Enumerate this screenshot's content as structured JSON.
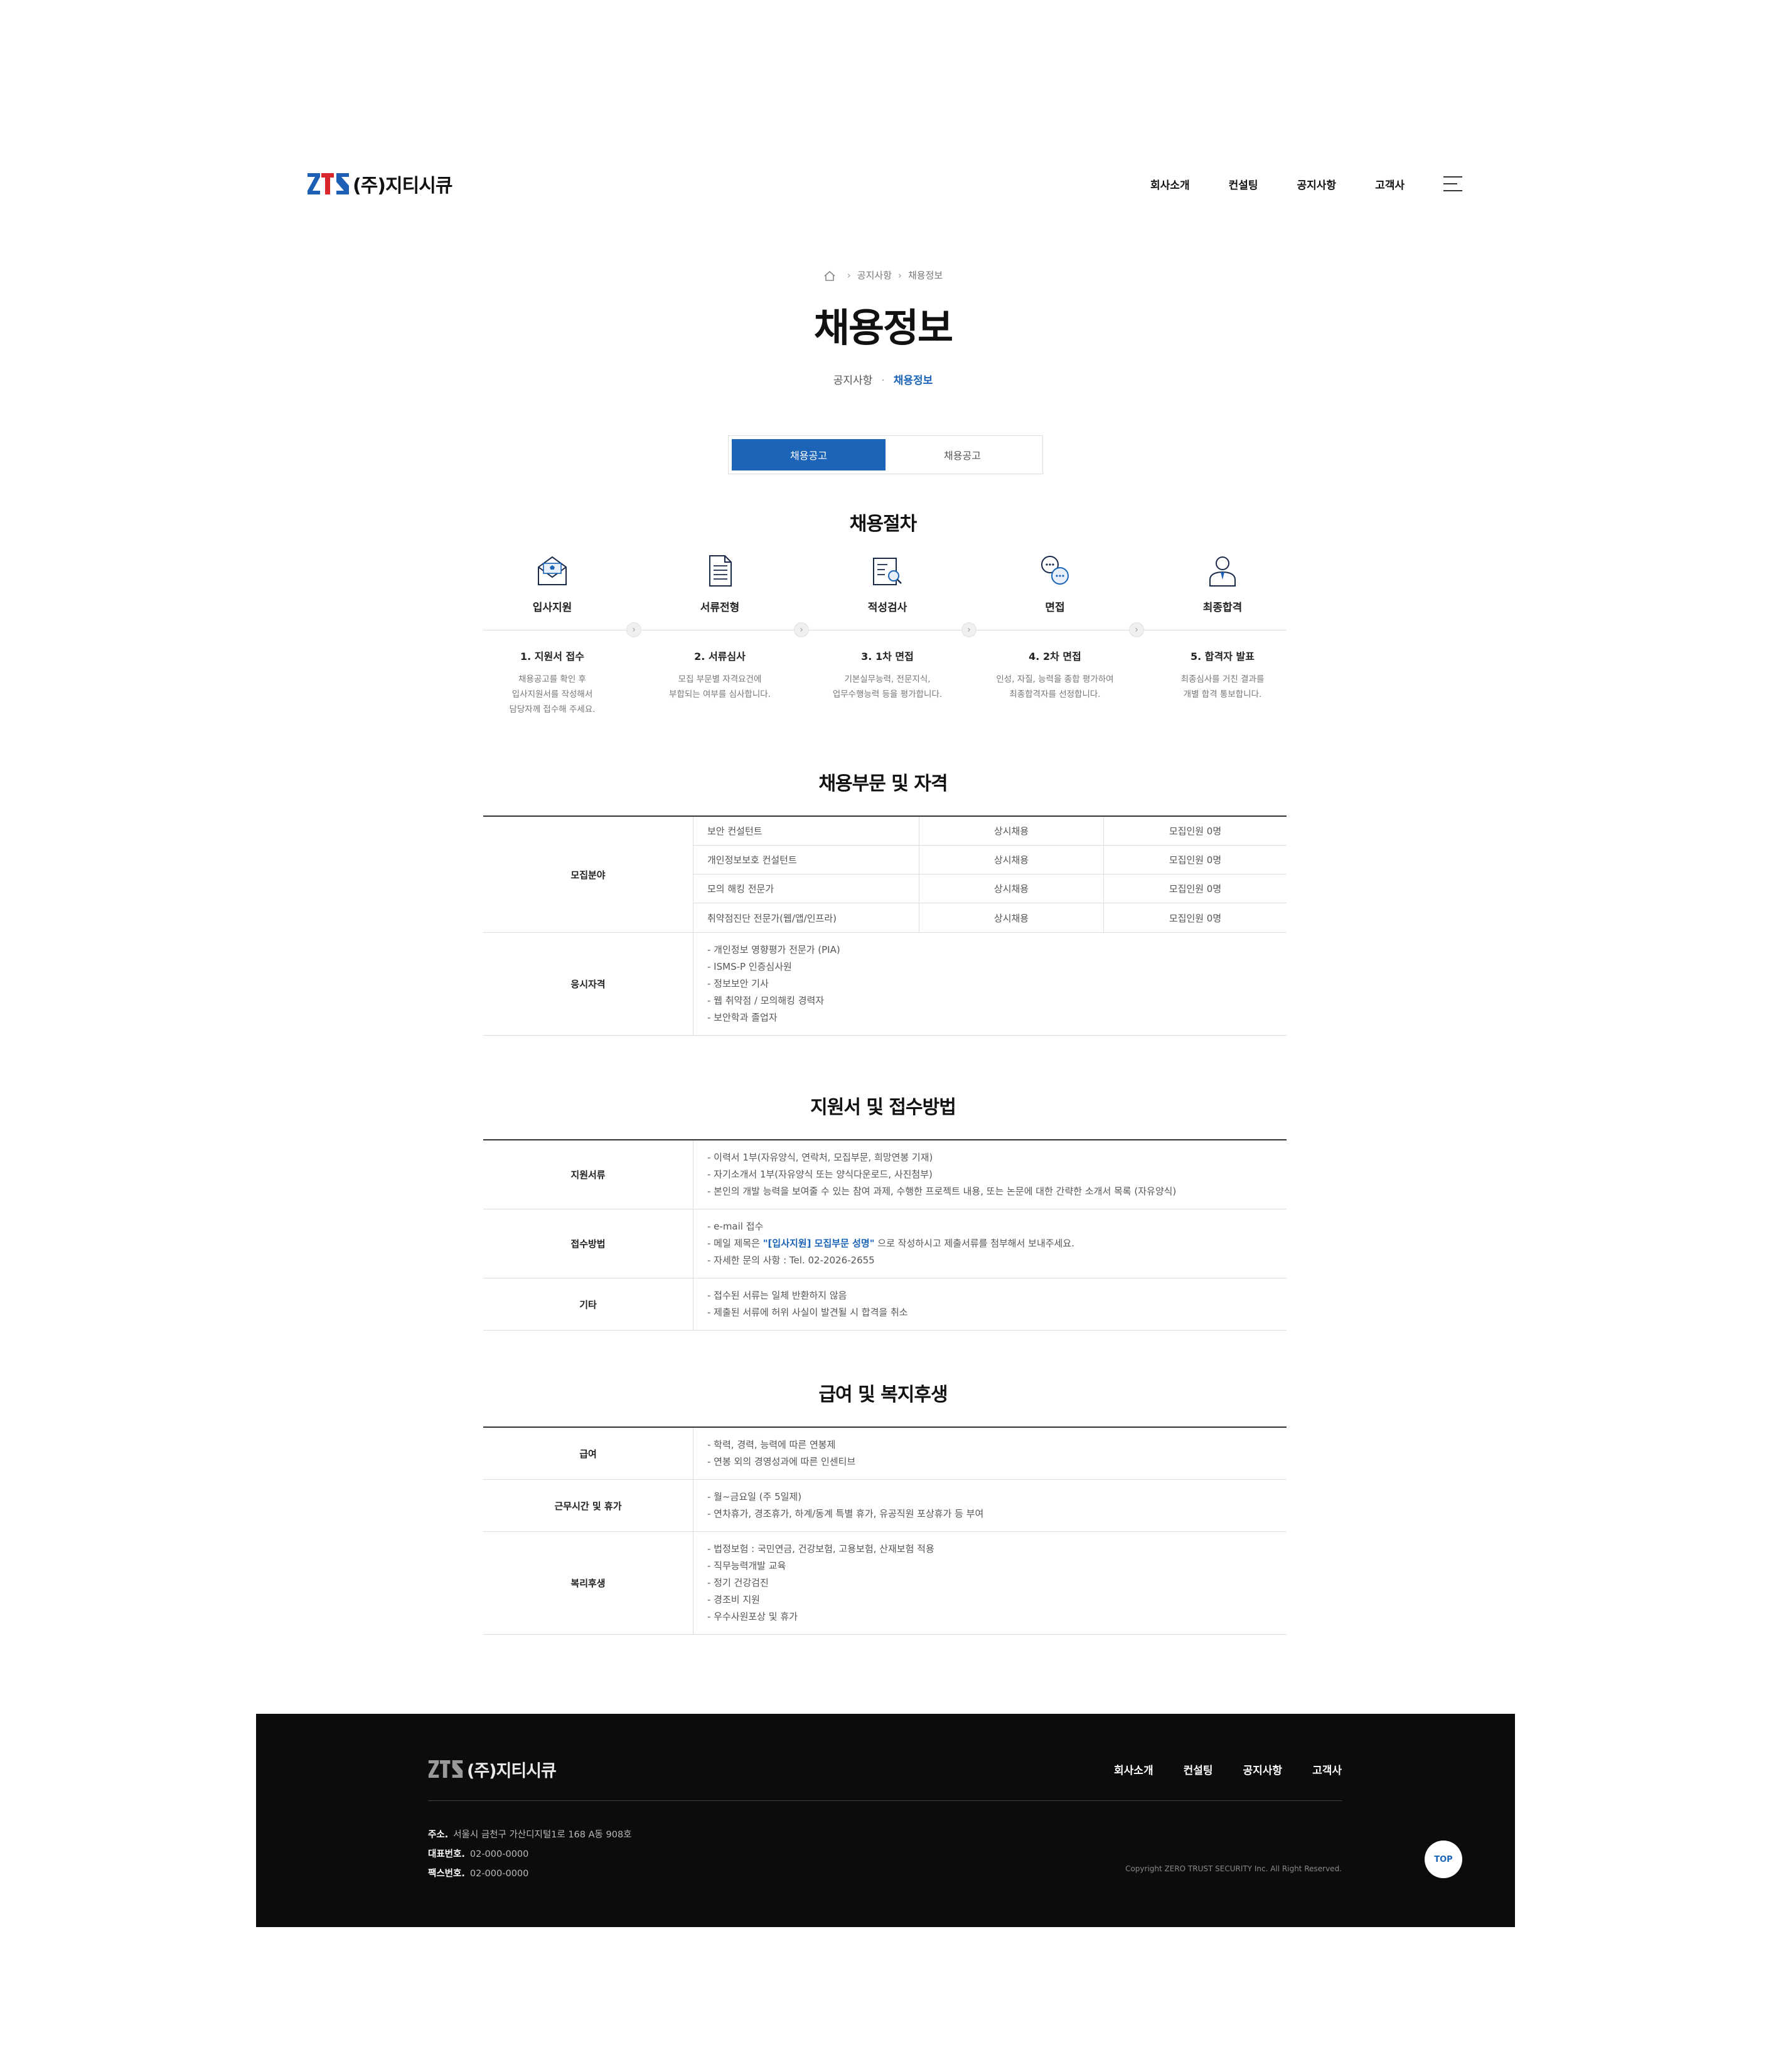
{
  "header": {
    "logo_text": "(주)지티시큐",
    "nav": [
      "회사소개",
      "컨설팅",
      "공지사항",
      "고객사"
    ]
  },
  "breadcrumb": [
    "공지사항",
    "채용정보"
  ],
  "page_title": "채용정보",
  "sub_path": {
    "parent": "공지사항",
    "current": "채용정보"
  },
  "tabs": [
    "채용공고",
    "채용공고"
  ],
  "process": {
    "title": "채용절차",
    "steps": [
      {
        "icon": "envelope-icon",
        "label": "입사지원",
        "num": "1. 지원서 접수",
        "desc": "채용공고를 확인 후\n입사지원서를 작성해서\n담당자께 접수해 주세요."
      },
      {
        "icon": "document-icon",
        "label": "서류전형",
        "num": "2. 서류심사",
        "desc": "모집 부문별 자격요건에\n부합되는 여부를 심사합니다."
      },
      {
        "icon": "aptitude-test-icon",
        "label": "적성검사",
        "num": "3. 1차 면접",
        "desc": "기본실무능력, 전문지식,\n업무수행능력 등을 평가합니다."
      },
      {
        "icon": "interview-chat-icon",
        "label": "면접",
        "num": "4. 2차 면접",
        "desc": "인성, 자질, 능력을 종합 평가하여\n최종합격자를 선정합니다."
      },
      {
        "icon": "person-icon",
        "label": "최종합격",
        "num": "5. 합격자 발표",
        "desc": "최종심사를 거친 결과를\n개별 합격 통보합니다."
      }
    ]
  },
  "qualification": {
    "title": "채용부문 및 자격",
    "field_header": "모집분야",
    "fields": [
      {
        "name": "보안 컨설턴트",
        "type": "상시채용",
        "count": "모집인원 0명"
      },
      {
        "name": "개인정보보호 컨설턴트",
        "type": "상시채용",
        "count": "모집인원 0명"
      },
      {
        "name": "모의 해킹 전문가",
        "type": "상시채용",
        "count": "모집인원 0명"
      },
      {
        "name": "취약점진단 전문가(웹/앱/인프라)",
        "type": "상시채용",
        "count": "모집인원 0명"
      }
    ],
    "req_header": "응시자격",
    "requirements": [
      "- 개인정보 영향평가 전문가 (PIA)",
      "- ISMS-P 인증심사원",
      "- 정보보안 기사",
      "- 웹 취약점 / 모의해킹 경력자",
      "- 보안학과 졸업자"
    ]
  },
  "application": {
    "title": "지원서 및 접수방법",
    "docs_header": "지원서류",
    "docs": [
      "- 이력서 1부(자유양식, 연락처, 모집부문, 희망연봉 기재)",
      "- 자기소개서 1부(자유양식 또는 양식다운로드, 사진첨부)",
      "- 본인의 개발 능력을 보여줄 수 있는 참여 과제, 수행한 프로젝트 내용, 또는 논문에 대한 간략한 소개서 목록 (자유양식)"
    ],
    "method_header": "접수방법",
    "method_1": "- e-mail 접수",
    "method_2_pre": "- 메일 제목은 ",
    "method_2_hl": "\"[입사지원] 모집부문 성명\"",
    "method_2_post": " 으로 작성하시고 제출서류를 첨부해서 보내주세요.",
    "method_3": "- 자세한 문의 사항 : Tel. 02-2026-2655",
    "etc_header": "기타",
    "etc": [
      "- 접수된 서류는 일체 반환하지 않음",
      "- 제출된 서류에 허위 사실이 발견될 시 합격을 취소"
    ]
  },
  "welfare": {
    "title": "급여 및 복지후생",
    "rows": [
      {
        "header": "급여",
        "items": [
          "- 학력, 경력, 능력에 따른 연봉제",
          "- 연봉 외의 경영성과에 따른 인센티브"
        ]
      },
      {
        "header": "근무시간 및 휴가",
        "items": [
          "- 월~금요일 (주 5일제)",
          "- 연차휴가, 경조휴가, 하계/동계 특별 휴가, 유공직원 포상휴가 등 부여"
        ]
      },
      {
        "header": "복리후생",
        "items": [
          "- 법정보험 : 국민연금, 건강보험, 고용보험, 산재보험 적용",
          "- 직무능력개발 교육",
          "- 정기 건강검진",
          "- 경조비 지원",
          "- 우수사원포상 및 휴가"
        ]
      }
    ]
  },
  "footer": {
    "logo_text": "(주)지티시큐",
    "nav": [
      "회사소개",
      "컨설팅",
      "공지사항",
      "고객사"
    ],
    "address_label": "주소.",
    "address": "서울시 금천구 가산디지털1로 168 A동 908호",
    "tel_label": "대표번호.",
    "tel": "02-000-0000",
    "fax_label": "팩스번호.",
    "fax": "02-000-0000",
    "copyright": "Copyright ZERO TRUST SECURITY Inc. All Right Reserved.",
    "top_label": "TOP"
  },
  "colors": {
    "accent": "#1b64b8",
    "footer_bg": "#0c0c0c",
    "logo_red": "#d9262d",
    "logo_blue": "#1d5fb4"
  }
}
